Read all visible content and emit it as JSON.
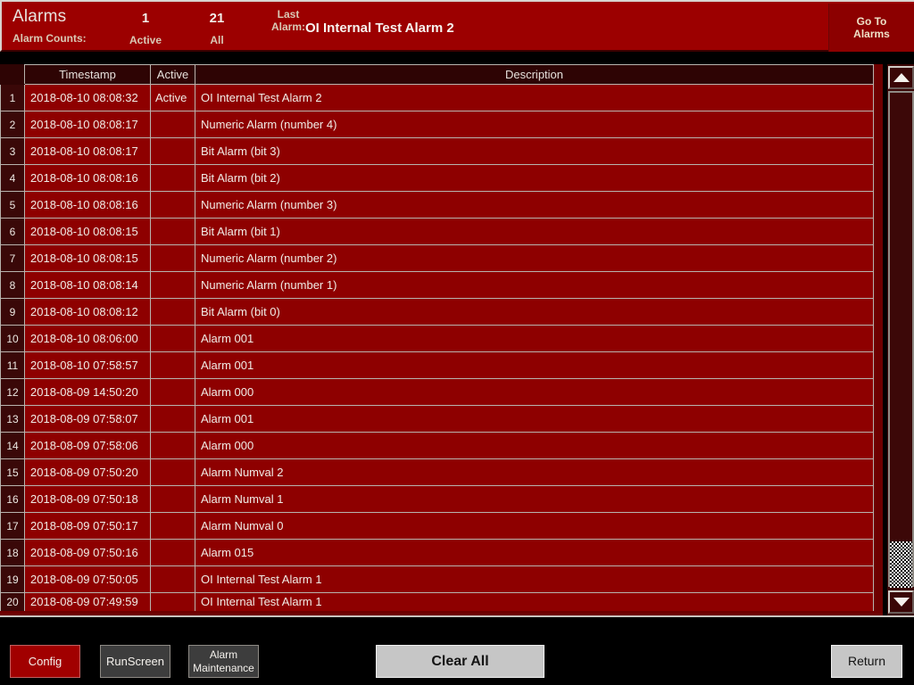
{
  "header": {
    "title": "Alarms",
    "counts_label": "Alarm Counts:",
    "active_count": "1",
    "active_label": "Active",
    "all_count": "21",
    "all_label": "All",
    "last_alarm_label_line1": "Last",
    "last_alarm_label_line2": "Alarm:",
    "last_alarm_value": "OI Internal Test Alarm 2",
    "goto_line1": "Go To",
    "goto_line2": "Alarms"
  },
  "table": {
    "columns": [
      "",
      "Timestamp",
      "Active",
      "Description"
    ],
    "rows": [
      {
        "num": "1",
        "timestamp": "2018-08-10 08:08:32",
        "active": "Active",
        "description": "OI Internal Test Alarm 2"
      },
      {
        "num": "2",
        "timestamp": "2018-08-10 08:08:17",
        "active": "",
        "description": "Numeric Alarm (number 4)"
      },
      {
        "num": "3",
        "timestamp": "2018-08-10 08:08:17",
        "active": "",
        "description": "Bit Alarm (bit 3)"
      },
      {
        "num": "4",
        "timestamp": "2018-08-10 08:08:16",
        "active": "",
        "description": "Bit Alarm (bit 2)"
      },
      {
        "num": "5",
        "timestamp": "2018-08-10 08:08:16",
        "active": "",
        "description": "Numeric Alarm (number 3)"
      },
      {
        "num": "6",
        "timestamp": "2018-08-10 08:08:15",
        "active": "",
        "description": "Bit Alarm (bit 1)"
      },
      {
        "num": "7",
        "timestamp": "2018-08-10 08:08:15",
        "active": "",
        "description": "Numeric Alarm (number 2)"
      },
      {
        "num": "8",
        "timestamp": "2018-08-10 08:08:14",
        "active": "",
        "description": "Numeric Alarm (number 1)"
      },
      {
        "num": "9",
        "timestamp": "2018-08-10 08:08:12",
        "active": "",
        "description": "Bit Alarm (bit 0)"
      },
      {
        "num": "10",
        "timestamp": "2018-08-10 08:06:00",
        "active": "",
        "description": "Alarm 001"
      },
      {
        "num": "11",
        "timestamp": "2018-08-10 07:58:57",
        "active": "",
        "description": "Alarm 001"
      },
      {
        "num": "12",
        "timestamp": "2018-08-09 14:50:20",
        "active": "",
        "description": "Alarm 000"
      },
      {
        "num": "13",
        "timestamp": "2018-08-09 07:58:07",
        "active": "",
        "description": "Alarm 001"
      },
      {
        "num": "14",
        "timestamp": "2018-08-09 07:58:06",
        "active": "",
        "description": "Alarm 000"
      },
      {
        "num": "15",
        "timestamp": "2018-08-09 07:50:20",
        "active": "",
        "description": "Alarm Numval 2"
      },
      {
        "num": "16",
        "timestamp": "2018-08-09 07:50:18",
        "active": "",
        "description": "Alarm Numval 1"
      },
      {
        "num": "17",
        "timestamp": "2018-08-09 07:50:17",
        "active": "",
        "description": "Alarm Numval 0"
      },
      {
        "num": "18",
        "timestamp": "2018-08-09 07:50:16",
        "active": "",
        "description": "Alarm 015"
      },
      {
        "num": "19",
        "timestamp": "2018-08-09 07:50:05",
        "active": "",
        "description": "OI Internal Test Alarm 1"
      },
      {
        "num": "20",
        "timestamp": "2018-08-09 07:49:59",
        "active": "",
        "description": "OI Internal Test Alarm 1"
      }
    ]
  },
  "scrollbar": {
    "up_icon": "triangle-up-icon",
    "down_icon": "triangle-down-icon"
  },
  "toolbar": {
    "config_label": "Config",
    "runscreen_label": "RunScreen",
    "alarm_maint_line1": "Alarm",
    "alarm_maint_line2": "Maintenance",
    "clear_all_label": "Clear All",
    "return_label": "Return"
  },
  "colors": {
    "header_red": "#9c0000",
    "row_red": "#8e0000",
    "dark_maroon": "#2e0404",
    "row_num_maroon": "#3a0808",
    "panel_red": "#6e0000",
    "grid_line": "#b8b4ae",
    "light_button": "#c6c6c6",
    "gray_button": "#3d3d3d",
    "config_red": "#a10000",
    "black": "#000000"
  }
}
